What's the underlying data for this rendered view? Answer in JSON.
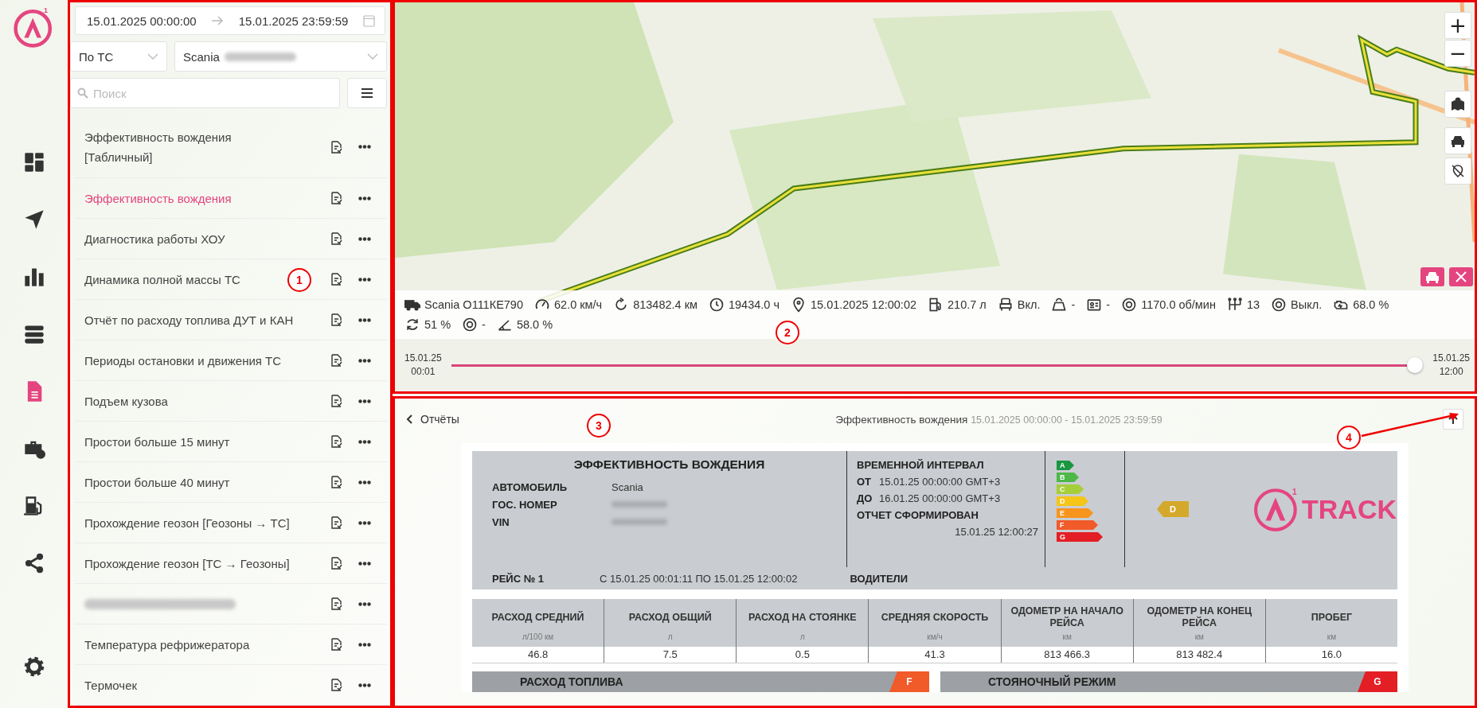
{
  "rail": {
    "logo_mark": "1",
    "items": [
      {
        "selected": false
      },
      {
        "selected": false
      },
      {
        "selected": false
      },
      {
        "selected": false
      },
      {
        "selected": true
      },
      {
        "selected": false
      },
      {
        "selected": false
      },
      {
        "selected": false
      }
    ]
  },
  "sidebar": {
    "date_from": "15.01.2025 00:00:00",
    "date_to": "15.01.2025 23:59:59",
    "group_by": "По ТС",
    "vehicle": "Scania",
    "vehicle_plate_blurred": true,
    "search": {
      "placeholder": "Поиск"
    },
    "reports": [
      {
        "kind": "report",
        "label": "Эффективность вождения [Табличный]",
        "selected": false
      },
      {
        "kind": "report",
        "label": "Эффективность вождения",
        "selected": true
      },
      {
        "kind": "report",
        "label": "Диагностика работы ХОУ",
        "selected": false
      },
      {
        "kind": "report",
        "label": "Динамика полной массы ТС",
        "selected": false
      },
      {
        "kind": "report",
        "label": "Отчёт по расходу топлива ДУТ и КАН",
        "selected": false
      },
      {
        "kind": "report",
        "label": "Периоды остановки и движения ТС",
        "selected": false
      },
      {
        "kind": "report",
        "label": "Подъем кузова",
        "selected": false
      },
      {
        "kind": "report",
        "label": "Простои больше 15 минут",
        "selected": false
      },
      {
        "kind": "report",
        "label": "Простои больше 40 минут",
        "selected": false
      },
      {
        "kind": "report",
        "label": "Прохождение геозон [Геозоны → ТС]",
        "selected": false
      },
      {
        "kind": "report",
        "label": "Прохождение геозон [ТС → Геозоны]",
        "selected": false
      },
      {
        "kind": "blurred",
        "selected": false
      },
      {
        "kind": "report",
        "label": "Температура рефрижератора",
        "selected": false
      },
      {
        "kind": "report",
        "label": "Термочек",
        "selected": false
      }
    ]
  },
  "map": {
    "zoom_in": "+",
    "zoom_out": "−",
    "info": [
      "Scania О111КЕ790",
      "62.0 км/ч",
      "813482.4 км",
      "19434.0 ч",
      "15.01.2025 12:00:02",
      "210.7 л",
      "Вкл.",
      "-",
      "-",
      "1170.0 об/мин",
      "13",
      "Выкл.",
      "68.0 %",
      "51 %",
      "-",
      "58.0 %"
    ],
    "timeline": {
      "start_date": "15.01.25",
      "start_time": "00:01",
      "end_date": "15.01.25",
      "end_time": "12:00",
      "level": 1.0
    }
  },
  "report": {
    "back": "Отчёты",
    "title": "Эффективность вождения",
    "period": "15.01.2025 00:00:00 - 15.01.2025 23:59:59",
    "header": {
      "title": "ЭФФЕКТИВНОСТЬ ВОЖДЕНИЯ",
      "fields": [
        {
          "label": "АВТОМОБИЛЬ",
          "value": "Scania",
          "blurred": false
        },
        {
          "label": "ГОС. НОМЕР",
          "blurred": true
        },
        {
          "label": "VIN",
          "blurred": true
        }
      ],
      "interval_title": "ВРЕМЕННОЙ ИНТЕРВАЛ",
      "from_label": "ОТ",
      "from": "15.01.25 00:00:00 GMT+3",
      "to_label": "ДО",
      "to": "16.01.25 00:00:00 GMT+3",
      "generated_label": "ОТЧЕТ СФОРМИРОВАН",
      "generated": "15.01.25 12:00:27",
      "trip_label": "РЕЙС № 1",
      "trip": "С 15.01.25 00:01:11 ПО 15.01.25 12:00:02",
      "drivers_label": "ВОДИТЕЛИ",
      "scale": [
        {
          "grade": "A",
          "color": "#1a9641"
        },
        {
          "grade": "B",
          "color": "#4cb848"
        },
        {
          "grade": "C",
          "color": "#a6ce39"
        },
        {
          "grade": "D",
          "color": "#f5c518"
        },
        {
          "grade": "E",
          "color": "#f7941d"
        },
        {
          "grade": "F",
          "color": "#f15a29"
        },
        {
          "grade": "G",
          "color": "#e31e24"
        }
      ],
      "rating": {
        "grade": "D",
        "color": "#d4a82a"
      },
      "logo_mark": "1",
      "logo_text": "TRACK"
    },
    "columns": [
      {
        "title": "РАСХОД СРЕДНИЙ",
        "unit": "л/100 км",
        "value": "46.8"
      },
      {
        "title": "РАСХОД ОБЩИЙ",
        "unit": "л",
        "value": "7.5"
      },
      {
        "title": "РАСХОД НА СТОЯНКЕ",
        "unit": "л",
        "value": "0.5"
      },
      {
        "title": "СРЕДНЯЯ СКОРОСТЬ",
        "unit": "км/ч",
        "value": "41.3"
      },
      {
        "title": "ОДОМЕТР НА НАЧАЛО РЕЙСА",
        "unit": "км",
        "value": "813 466.3"
      },
      {
        "title": "ОДОМЕТР НА КОНЕЦ РЕЙСА",
        "unit": "км",
        "value": "813 482.4"
      },
      {
        "title": "ПРОБЕГ",
        "unit": "км",
        "value": "16.0"
      }
    ],
    "sections": [
      {
        "title": "РАСХОД ТОПЛИВА",
        "grade": "F",
        "color": "#f15a29"
      },
      {
        "title": "СТОЯНОЧНЫЙ РЕЖИМ",
        "grade": "G",
        "color": "#e31e24"
      }
    ]
  },
  "annotations": [
    "1",
    "2",
    "3",
    "4"
  ]
}
